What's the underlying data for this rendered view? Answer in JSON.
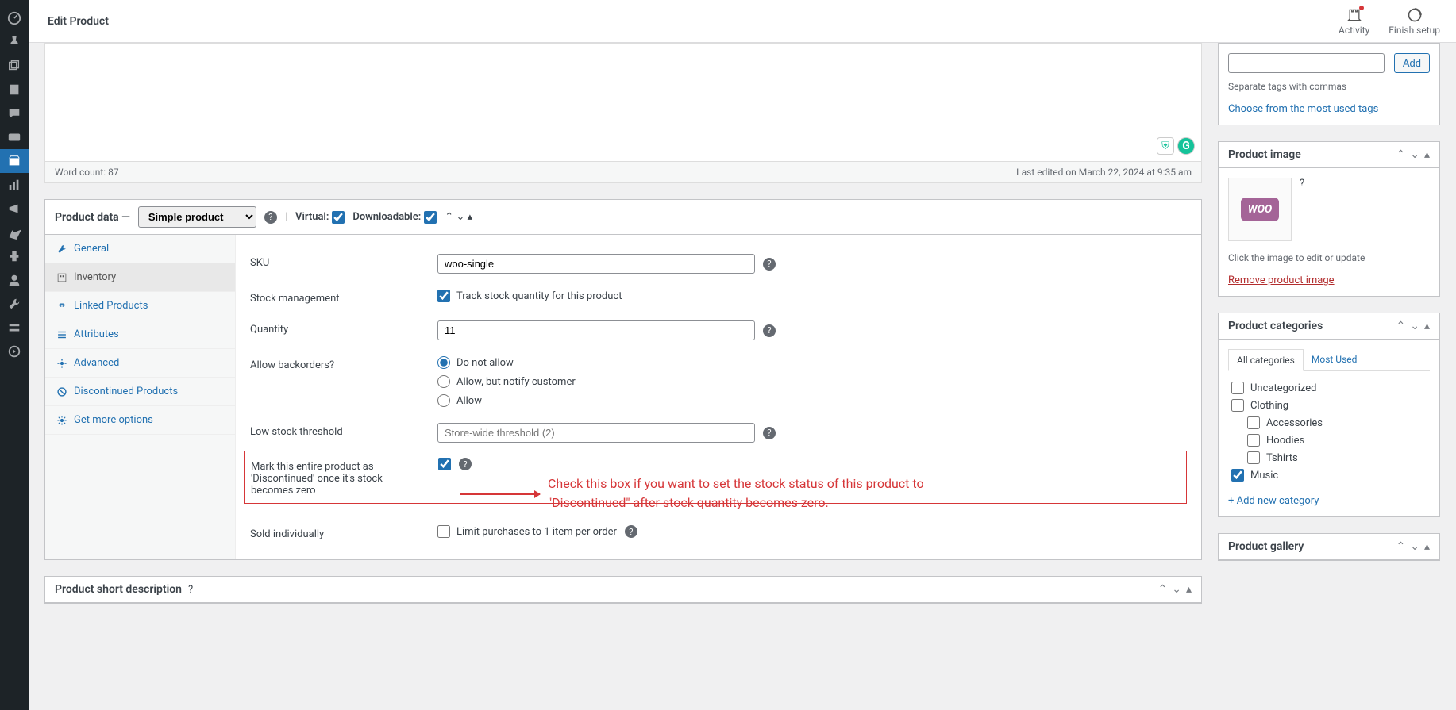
{
  "header": {
    "title": "Edit Product",
    "activity": "Activity",
    "finish": "Finish setup"
  },
  "editor": {
    "word_count": "Word count: 87",
    "last_edited": "Last edited on March 22, 2024 at 9:35 am"
  },
  "product_data": {
    "title": "Product data —",
    "type": "Simple product",
    "virtual_label": "Virtual:",
    "downloadable_label": "Downloadable:",
    "virtual": true,
    "downloadable": true,
    "tabs": {
      "general": "General",
      "inventory": "Inventory",
      "linked": "Linked Products",
      "attributes": "Attributes",
      "advanced": "Advanced",
      "discontinued": "Discontinued Products",
      "more": "Get more options"
    },
    "fields": {
      "sku_label": "SKU",
      "sku_value": "woo-single",
      "stock_mgmt_label": "Stock management",
      "track_label": "Track stock quantity for this product",
      "quantity_label": "Quantity",
      "quantity_value": "11",
      "backorders_label": "Allow backorders?",
      "backorder_no": "Do not allow",
      "backorder_notify": "Allow, but notify customer",
      "backorder_yes": "Allow",
      "low_stock_label": "Low stock threshold",
      "low_stock_placeholder": "Store-wide threshold (2)",
      "discontinued_label": "Mark this entire product as 'Discontinued' once it's stock becomes zero",
      "sold_individually_label": "Sold individually",
      "sold_individually_desc": "Limit purchases to 1 item per order"
    }
  },
  "short_desc": {
    "title": "Product short description"
  },
  "tags_box": {
    "add": "Add",
    "hint": "Separate tags with commas",
    "choose": "Choose from the most used tags"
  },
  "image_box": {
    "title": "Product image",
    "hint": "Click the image to edit or update",
    "remove": "Remove product image"
  },
  "categories_box": {
    "title": "Product categories",
    "tab_all": "All categories",
    "tab_most": "Most Used",
    "cats": {
      "uncategorized": "Uncategorized",
      "clothing": "Clothing",
      "accessories": "Accessories",
      "hoodies": "Hoodies",
      "tshirts": "Tshirts",
      "music": "Music"
    },
    "add_new": "+ Add new category"
  },
  "gallery_box": {
    "title": "Product gallery"
  },
  "annotation": {
    "text": "Check this box if you want to set the stock status of this product to \"Discontinued\" after stock quantity becomes zero."
  }
}
